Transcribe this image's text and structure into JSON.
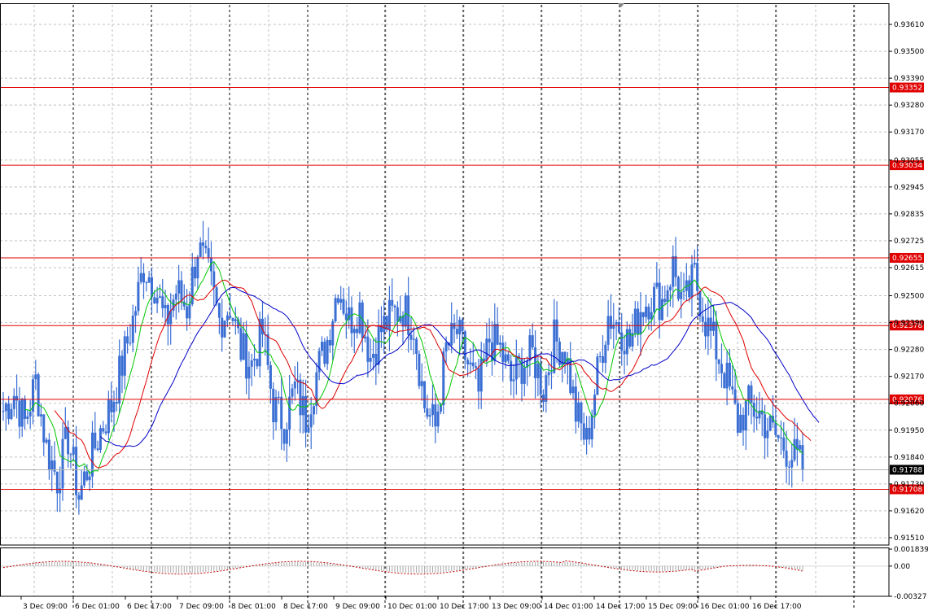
{
  "chart_data": {
    "type": "candlestick",
    "instrument_timeframe": "",
    "price_axis_labels": [
      "0.93610",
      "0.93500",
      "0.93390",
      "0.93280",
      "0.93170",
      "0.93055",
      "0.92945",
      "0.92835",
      "0.92725",
      "0.92615",
      "0.92500",
      "0.92390",
      "0.92280",
      "0.92170",
      "0.92060",
      "0.91950",
      "0.91840",
      "0.91730",
      "0.91620",
      "0.91510"
    ],
    "ylim": [
      0.9148,
      0.9369
    ],
    "time_axis_labels": [
      "3 Dec 09:00",
      "6 Dec 01:00",
      "6 Dec 17:00",
      "7 Dec 09:00",
      "8 Dec 01:00",
      "8 Dec 17:00",
      "9 Dec 09:00",
      "10 Dec 01:00",
      "10 Dec 17:00",
      "13 Dec 09:00",
      "14 Dec 01:00",
      "14 Dec 17:00",
      "15 Dec 09:00",
      "16 Dec 01:00",
      "16 Dec 17:00"
    ],
    "current_price": "0.91788",
    "horizontal_levels": [
      {
        "value": 0.93352,
        "label": "0.93352"
      },
      {
        "value": 0.93034,
        "label": "0.93034"
      },
      {
        "value": 0.92655,
        "label": "0.92655"
      },
      {
        "value": 0.92378,
        "label": "0.92378"
      },
      {
        "value": 0.92076,
        "label": "0.92076"
      },
      {
        "value": 0.91708,
        "label": "0.91708"
      }
    ],
    "close_series": [
      0.9203,
      0.921,
      0.9198,
      0.9215,
      0.9188,
      0.9175,
      0.9192,
      0.9168,
      0.9182,
      0.9195,
      0.9205,
      0.9222,
      0.924,
      0.9262,
      0.9255,
      0.9238,
      0.9252,
      0.9245,
      0.927,
      0.9258,
      0.924,
      0.9246,
      0.9228,
      0.9222,
      0.9235,
      0.9205,
      0.9198,
      0.9212,
      0.92,
      0.9218,
      0.9232,
      0.9255,
      0.924,
      0.9245,
      0.9225,
      0.9236,
      0.9242,
      0.9245,
      0.9238,
      0.9205,
      0.9196,
      0.9228,
      0.9235,
      0.9222,
      0.921,
      0.9232,
      0.9228,
      0.9215,
      0.9222,
      0.9226,
      0.9212,
      0.9232,
      0.9228,
      0.9202,
      0.919,
      0.9218,
      0.9242,
      0.9238,
      0.923,
      0.9245,
      0.925,
      0.9248,
      0.9262,
      0.9245,
      0.9258,
      0.924,
      0.9228,
      0.9215,
      0.9198,
      0.9205,
      0.9202,
      0.9195,
      0.919,
      0.9185,
      0.918
    ],
    "moving_averages": [
      {
        "color": "#00c800"
      },
      {
        "color": "#e00000"
      },
      {
        "color": "#0000c8"
      }
    ],
    "indicator": {
      "axis_labels": [
        "0.001839",
        "0.00",
        "-0.00327"
      ],
      "ylim": [
        -0.00327,
        0.001839
      ]
    },
    "colors": {
      "candles": "#3b6fd4",
      "levels": "#e00000",
      "grid": "#c0c0c0",
      "separators": "#000000",
      "osc_line": "#c00000",
      "histogram": "#a8a8a8",
      "current_price_badge": "#000000"
    }
  }
}
